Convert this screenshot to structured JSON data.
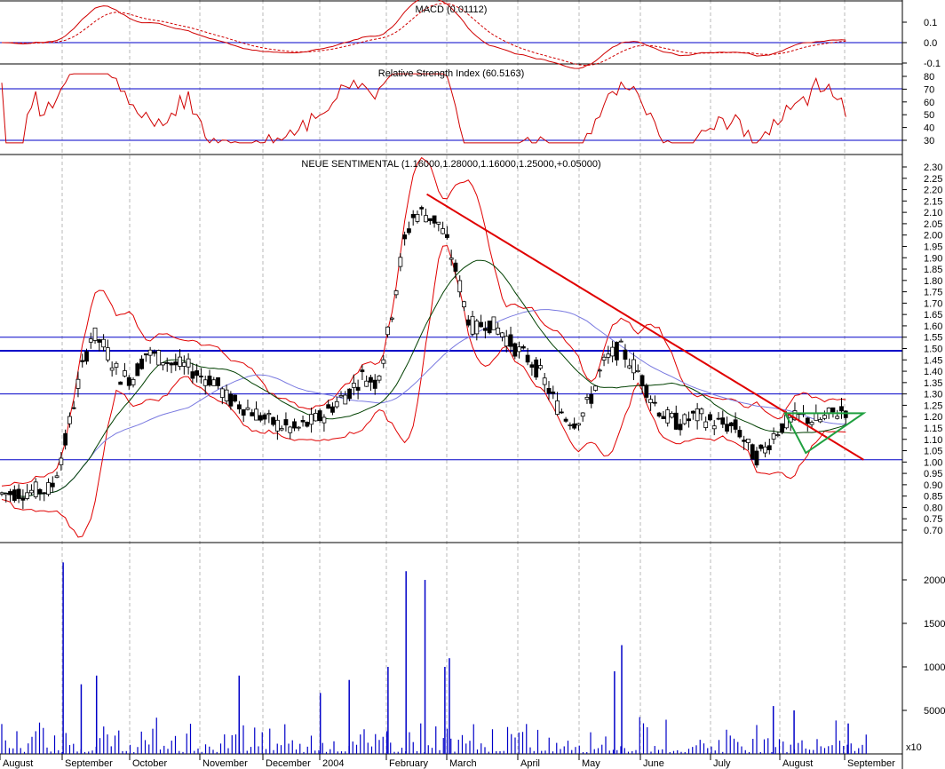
{
  "chart_data": {
    "type": "candlestick-with-indicators",
    "x_axis": {
      "labels": [
        "August",
        "September",
        "October",
        "November",
        "December",
        "2004",
        "February",
        "March",
        "April",
        "May",
        "June",
        "July",
        "August",
        "September"
      ]
    },
    "panels": {
      "macd": {
        "title": "MACD (0.01112)",
        "ylim": [
          -0.15,
          0.15
        ],
        "ticks": [
          0.1,
          0.0,
          -0.1
        ],
        "tick_labels": [
          "0.1",
          "0.0",
          "-0.1"
        ]
      },
      "rsi": {
        "title": "Relative Strength Index (60.5163)",
        "ylim": [
          20,
          85
        ],
        "ticks": [
          80,
          70,
          60,
          50,
          40,
          30
        ],
        "tick_labels": [
          "80",
          "70",
          "60",
          "50",
          "40",
          "30"
        ],
        "reference_lines": [
          70,
          30
        ]
      },
      "price": {
        "title": "NEUE SENTIMENTAL (1.16000,1.28000,1.16000,1.25000,+0.05000)",
        "ylim": [
          0.65,
          2.32
        ],
        "ticks": [
          2.3,
          2.25,
          2.2,
          2.15,
          2.1,
          2.05,
          2.0,
          1.95,
          1.9,
          1.85,
          1.8,
          1.75,
          1.7,
          1.65,
          1.6,
          1.55,
          1.5,
          1.45,
          1.4,
          1.35,
          1.3,
          1.25,
          1.2,
          1.15,
          1.1,
          1.05,
          1.0,
          0.95,
          0.9,
          0.85,
          0.8,
          0.75,
          0.7
        ],
        "tick_labels": [
          "2.30",
          "2.25",
          "2.20",
          "2.15",
          "2.10",
          "2.05",
          "2.00",
          "1.95",
          "1.90",
          "1.85",
          "1.80",
          "1.75",
          "1.70",
          "1.65",
          "1.60",
          "1.55",
          "1.50",
          "1.45",
          "1.40",
          "1.35",
          "1.30",
          "1.25",
          "1.20",
          "1.15",
          "1.10",
          "1.05",
          "1.00",
          "0.95",
          "0.90",
          "0.85",
          "0.80",
          "0.75",
          "0.70"
        ],
        "horizontal_levels": [
          1.55,
          1.49,
          1.3,
          1.01
        ],
        "trendline": {
          "from": [
            0.473,
            2.18
          ],
          "to": [
            0.957,
            1.01
          ]
        },
        "triangle": {
          "x": [
            0.87,
            0.957
          ],
          "top": 1.215,
          "bottom_from": 1.04,
          "bottom_to": 1.215
        },
        "price_series": [
          [
            0.0,
            0.86
          ],
          [
            0.03,
            0.87
          ],
          [
            0.055,
            0.88
          ],
          [
            0.07,
            1.08
          ],
          [
            0.085,
            1.35
          ],
          [
            0.1,
            1.57
          ],
          [
            0.115,
            1.5
          ],
          [
            0.13,
            1.38
          ],
          [
            0.145,
            1.37
          ],
          [
            0.16,
            1.48
          ],
          [
            0.175,
            1.46
          ],
          [
            0.19,
            1.43
          ],
          [
            0.205,
            1.42
          ],
          [
            0.22,
            1.38
          ],
          [
            0.235,
            1.36
          ],
          [
            0.25,
            1.28
          ],
          [
            0.265,
            1.25
          ],
          [
            0.28,
            1.22
          ],
          [
            0.295,
            1.18
          ],
          [
            0.31,
            1.16
          ],
          [
            0.325,
            1.14
          ],
          [
            0.34,
            1.17
          ],
          [
            0.355,
            1.2
          ],
          [
            0.37,
            1.26
          ],
          [
            0.385,
            1.31
          ],
          [
            0.4,
            1.38
          ],
          [
            0.415,
            1.35
          ],
          [
            0.425,
            1.5
          ],
          [
            0.435,
            1.72
          ],
          [
            0.445,
            1.95
          ],
          [
            0.455,
            2.08
          ],
          [
            0.465,
            2.1
          ],
          [
            0.475,
            2.08
          ],
          [
            0.485,
            2.05
          ],
          [
            0.495,
            1.95
          ],
          [
            0.505,
            1.82
          ],
          [
            0.515,
            1.65
          ],
          [
            0.525,
            1.58
          ],
          [
            0.535,
            1.62
          ],
          [
            0.545,
            1.6
          ],
          [
            0.555,
            1.57
          ],
          [
            0.565,
            1.52
          ],
          [
            0.575,
            1.48
          ],
          [
            0.585,
            1.45
          ],
          [
            0.595,
            1.4
          ],
          [
            0.605,
            1.33
          ],
          [
            0.615,
            1.25
          ],
          [
            0.625,
            1.2
          ],
          [
            0.635,
            1.18
          ],
          [
            0.645,
            1.22
          ],
          [
            0.655,
            1.3
          ],
          [
            0.665,
            1.42
          ],
          [
            0.675,
            1.47
          ],
          [
            0.685,
            1.5
          ],
          [
            0.695,
            1.45
          ],
          [
            0.705,
            1.4
          ],
          [
            0.715,
            1.32
          ],
          [
            0.725,
            1.25
          ],
          [
            0.735,
            1.2
          ],
          [
            0.745,
            1.18
          ],
          [
            0.755,
            1.17
          ],
          [
            0.765,
            1.2
          ],
          [
            0.775,
            1.2
          ],
          [
            0.785,
            1.18
          ],
          [
            0.795,
            1.17
          ],
          [
            0.805,
            1.16
          ],
          [
            0.815,
            1.15
          ],
          [
            0.825,
            1.08
          ],
          [
            0.835,
            1.02
          ],
          [
            0.845,
            1.05
          ],
          [
            0.855,
            1.12
          ],
          [
            0.865,
            1.16
          ],
          [
            0.875,
            1.18
          ],
          [
            0.885,
            1.2
          ],
          [
            0.895,
            1.19
          ],
          [
            0.905,
            1.18
          ],
          [
            0.915,
            1.2
          ],
          [
            0.925,
            1.22
          ],
          [
            0.935,
            1.23
          ]
        ]
      },
      "volume": {
        "ylim": [
          0,
          24000
        ],
        "ticks": [
          20000,
          15000,
          10000,
          5000
        ],
        "tick_labels": [
          "20000",
          "15000",
          "10000",
          "5000"
        ],
        "multiplier_label": "x10",
        "spikes": [
          [
            0.07,
            22000
          ],
          [
            0.107,
            9000
          ],
          [
            0.09,
            8000
          ],
          [
            0.265,
            9000
          ],
          [
            0.45,
            21000
          ],
          [
            0.471,
            20000
          ],
          [
            0.498,
            11000
          ],
          [
            0.493,
            10000
          ],
          [
            0.43,
            10000
          ],
          [
            0.689,
            12500
          ],
          [
            0.681,
            9500
          ],
          [
            0.387,
            8500
          ],
          [
            0.355,
            7000
          ],
          [
            0.857,
            5500
          ],
          [
            0.88,
            5000
          ],
          [
            0.94,
            3500
          ]
        ]
      }
    }
  }
}
